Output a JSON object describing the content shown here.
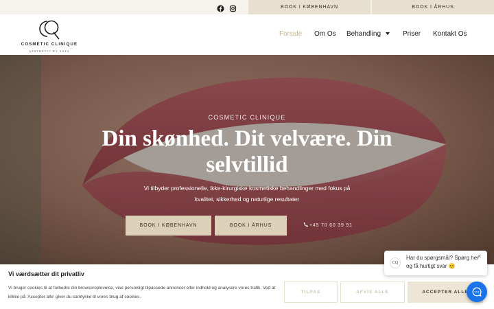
{
  "topbar": {
    "icons": [
      "facebook-icon",
      "instagram-icon"
    ],
    "book_copenhagen": "BOOK I KØBENHAVN",
    "book_aarhus": "BOOK I ÅRHUS"
  },
  "header": {
    "logo_brand": "COSMETIC CLINIQUE",
    "logo_tagline": "AESTHETIC BY SAFA",
    "nav": [
      "Forside",
      "Om Os",
      "Behandling",
      "Priser",
      "Kontakt Os"
    ],
    "active_nav": "Forside"
  },
  "hero": {
    "eyebrow": "COSMETIC CLINIQUE",
    "headline": "Din skønhed. Dit velvære. Din selvtillid",
    "description": "Vi tilbyder professionelle, ikke-kirurgiske kosmetiske behandlinger med fokus på kvalitet, sikkerhed og naturlige resultater",
    "cta_copenhagen": "BOOK I KØBENHAVN",
    "cta_aarhus": "BOOK I ÅRHUS",
    "phone": "+45 70 60 39 91"
  },
  "cookie": {
    "title": "Vi værdsætter dit privatliv",
    "text": "Vi bruger cookies til at forbedre din browseroplevelse, vise personligt tilpassede annoncer eller indhold og analysere vores trafik. Ved at klikke på 'Accepter alle' giver du samtykke til vores brug af cookies.",
    "customize": "TILPAS",
    "reject": "AFVIS ALLE",
    "accept": "ACCEPTER ALLE"
  },
  "chat": {
    "message": "Har du spørgsmål? Spørg her og få hurtigt svar 😊",
    "close": "×",
    "avatar": "CQ"
  },
  "colors": {
    "accent": "#c9b98d",
    "button_bg": "#ddd0b8",
    "topbar_bg": "#f6f3ec",
    "chat_blue": "#1a73e8"
  }
}
